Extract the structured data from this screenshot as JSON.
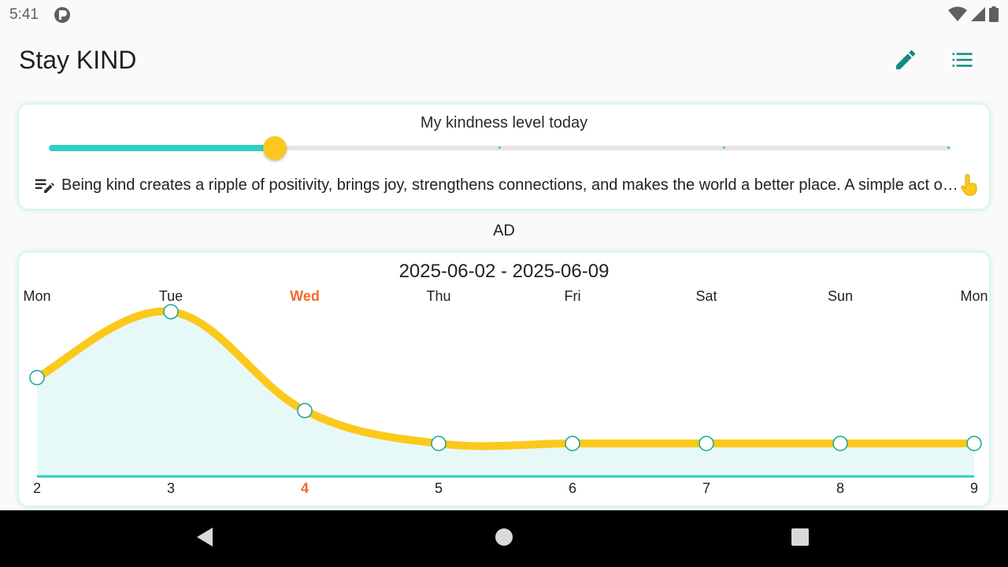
{
  "status": {
    "time": "5:41"
  },
  "app": {
    "title": "Stay KIND",
    "icons": {
      "edit": "pencil-icon",
      "list": "list-icon"
    },
    "accent": "#128a80"
  },
  "kindness": {
    "title": "My kindness level today",
    "level_fraction": 0.25,
    "note": "Being kind creates a ripple of positivity, brings joy, strengthens connections, and makes the world a better place. A simple act of kindness can brighten someone's day.",
    "icons": {
      "note": "edit-note-icon",
      "tap": "tap-hand-icon"
    }
  },
  "ad": {
    "label": "AD"
  },
  "chart_data": {
    "type": "area",
    "title": "2025-06-02 - 2025-06-09",
    "weekdays": [
      "Mon",
      "Tue",
      "Wed",
      "Thu",
      "Fri",
      "Sat",
      "Sun",
      "Mon"
    ],
    "days": [
      "2",
      "3",
      "4",
      "5",
      "6",
      "7",
      "8",
      "9"
    ],
    "highlight_index": 2,
    "values": [
      3,
      5,
      2,
      1,
      1,
      1,
      1,
      1
    ],
    "ylim": [
      0,
      5.5
    ],
    "colors": {
      "line": "#fbc91c",
      "fill": "#e7f9f7",
      "marker": "#1aa597",
      "highlight": "#f26b2a",
      "baseline": "#2ecfc1"
    }
  }
}
